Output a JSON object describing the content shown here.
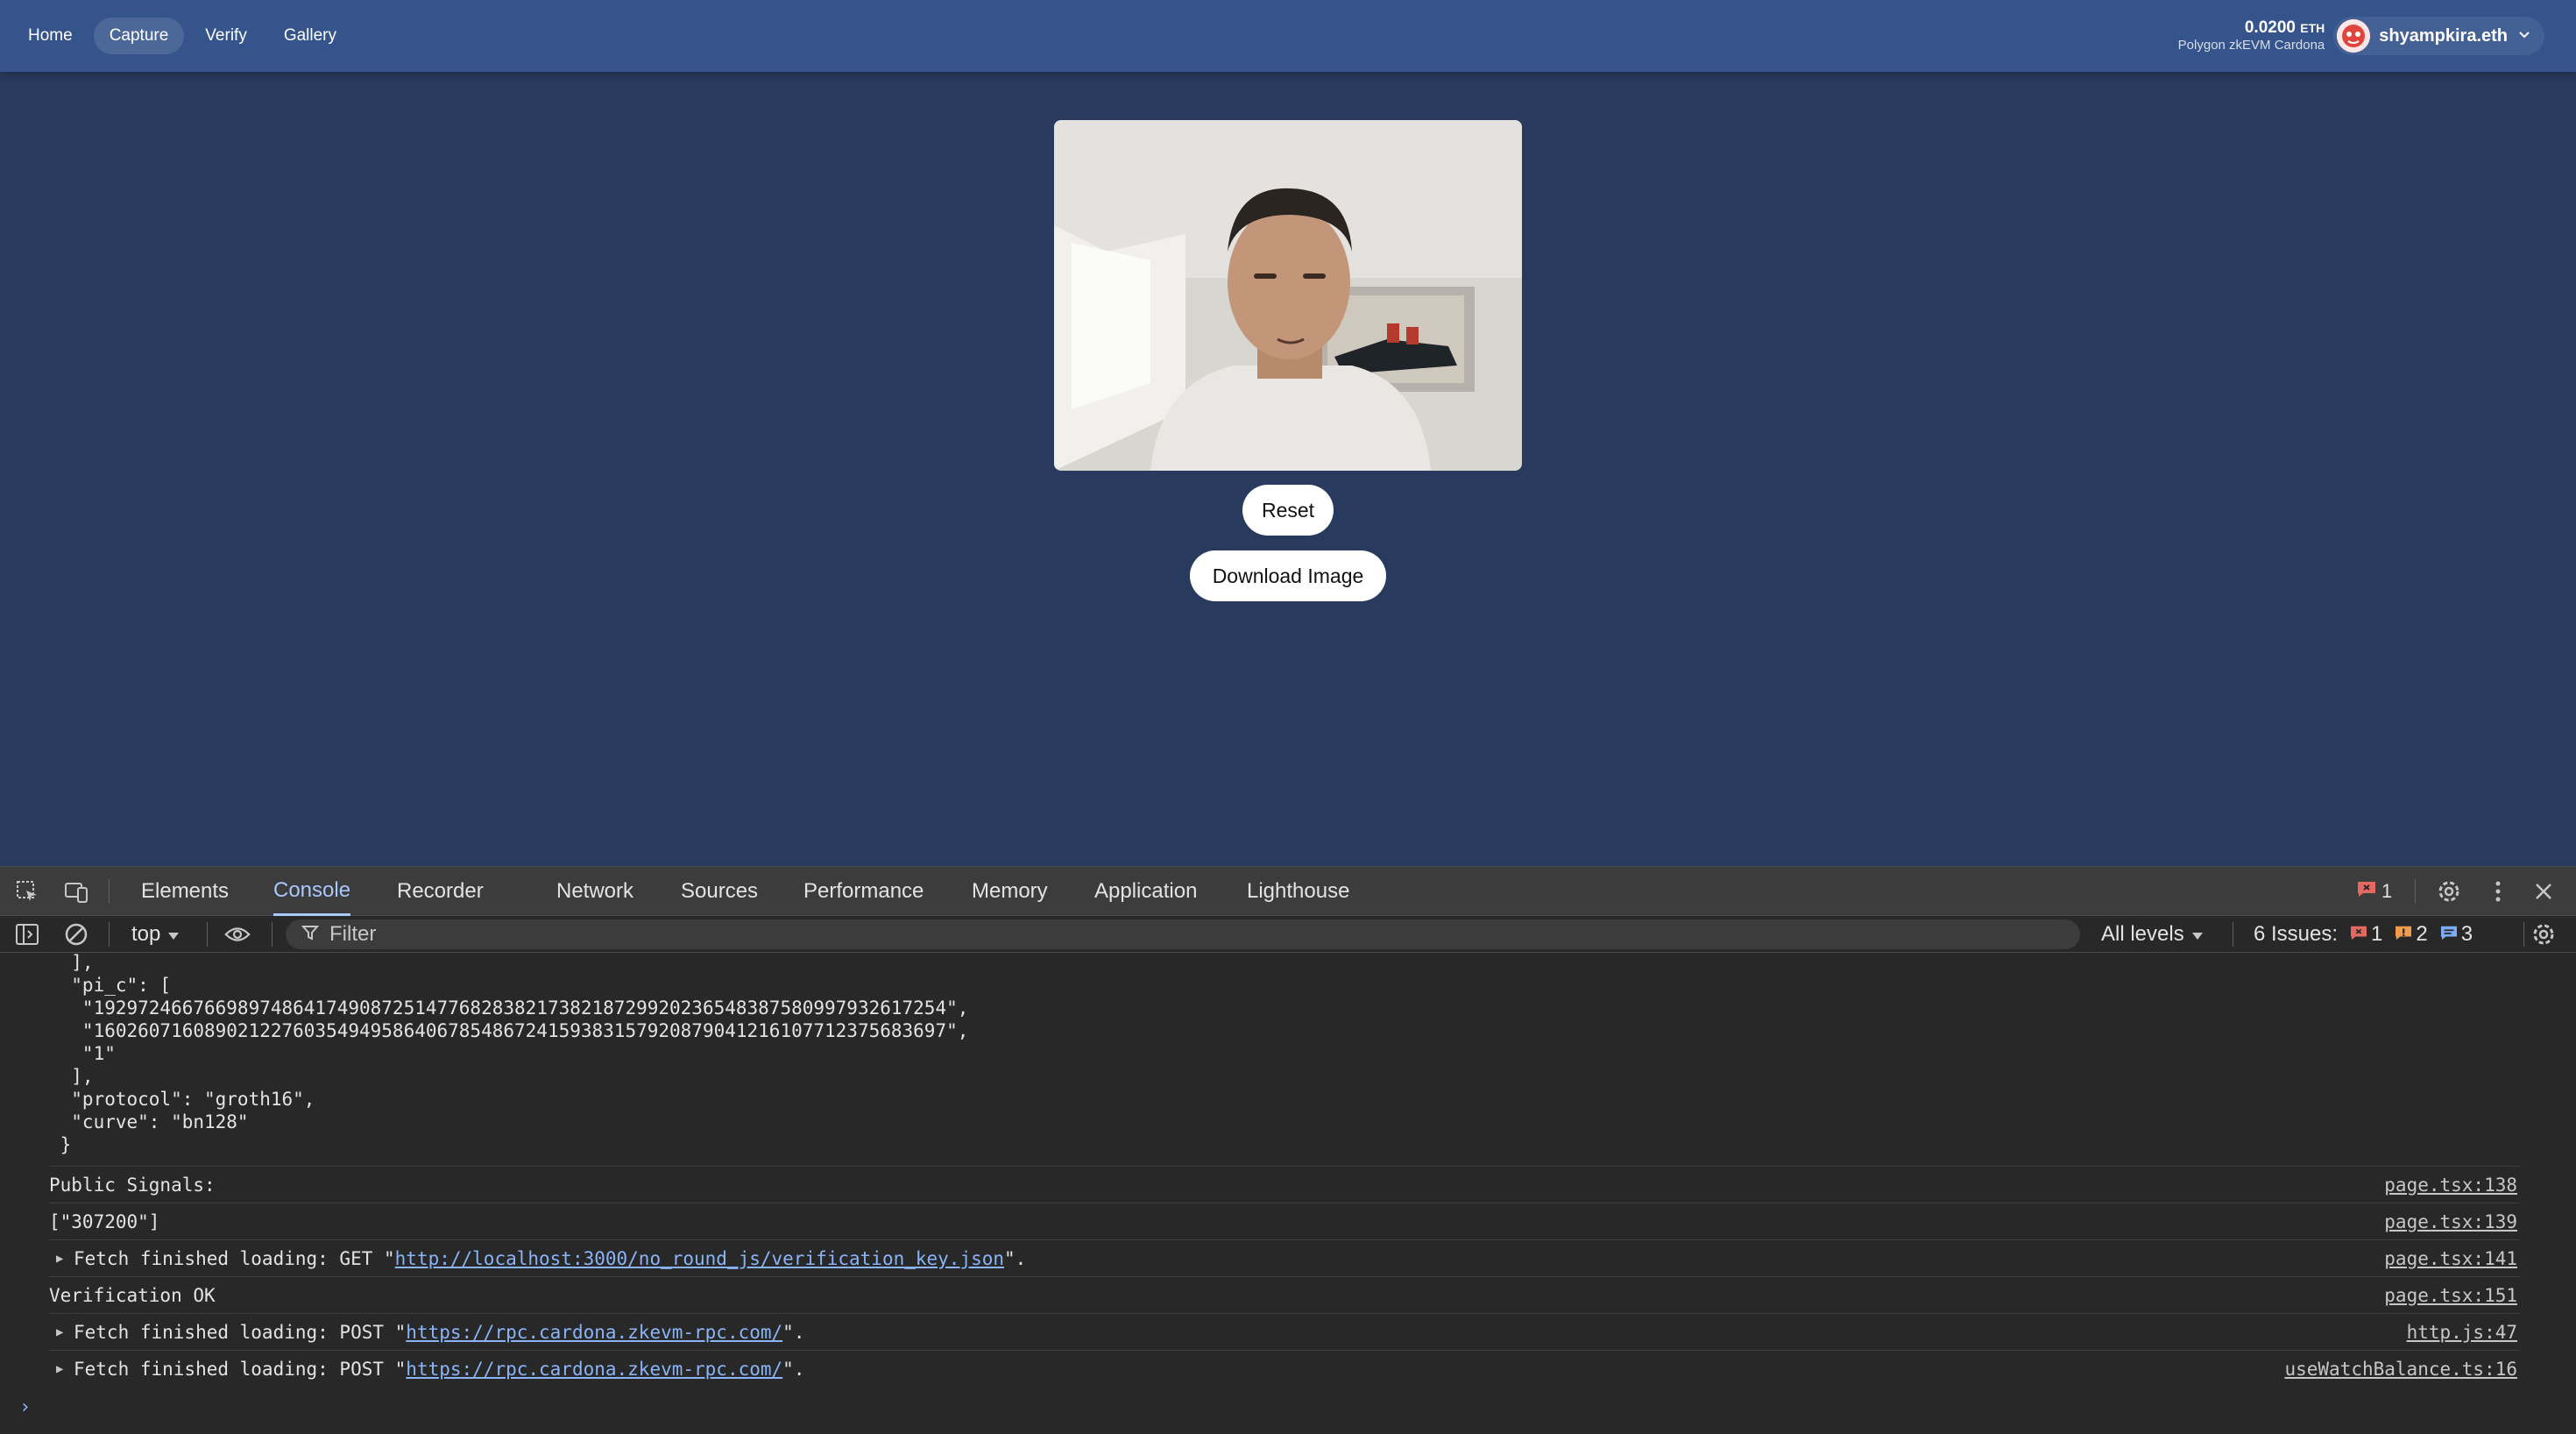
{
  "nav": {
    "links": [
      {
        "label": "Home",
        "active": false
      },
      {
        "label": "Capture",
        "active": true
      },
      {
        "label": "Verify",
        "active": false
      },
      {
        "label": "Gallery",
        "active": false
      }
    ],
    "balance_amount": "0.0200",
    "balance_unit": "ETH",
    "network": "Polygon zkEVM Cardona",
    "account_name": "shyampkira.eth"
  },
  "capture": {
    "reset_label": "Reset",
    "download_label": "Download Image"
  },
  "devtools": {
    "tabs": [
      "Elements",
      "Console",
      "Recorder",
      "Network",
      "Sources",
      "Performance",
      "Memory",
      "Application",
      "Lighthouse"
    ],
    "active_tab": "Console",
    "error_count": "1",
    "context": "top",
    "filter_placeholder": "Filter",
    "levels_label": "All levels",
    "issues_label": "6 Issues:",
    "issues": {
      "errors": "1",
      "warnings": "2",
      "info": "3"
    },
    "json_lines": [
      "  ],",
      "  \"pi_c\": [",
      "   \"19297246676698974864174908725147768283821738218729920236548387580997932617254\",",
      "   \"16026071608902122760354949586406785486724159383157920879041216107712375683697\",",
      "   \"1\"",
      "  ],",
      "  \"protocol\": \"groth16\",",
      "  \"curve\": \"bn128\"",
      " }"
    ],
    "messages": [
      {
        "text": "Public Signals:",
        "source": "page.tsx:138"
      },
      {
        "text": "[\"307200\"]",
        "source": "page.tsx:139"
      },
      {
        "prefix": "Fetch finished loading: GET \"",
        "url": "http://localhost:3000/no_round_js/verification_key.json",
        "suffix": "\".",
        "source": "page.tsx:141"
      },
      {
        "text": "Verification OK",
        "source": "page.tsx:151"
      },
      {
        "prefix": "Fetch finished loading: POST \"",
        "url": "https://rpc.cardona.zkevm-rpc.com/",
        "suffix": "\".",
        "source": "http.js:47"
      },
      {
        "prefix": "Fetch finished loading: POST \"",
        "url": "https://rpc.cardona.zkevm-rpc.com/",
        "suffix": "\".",
        "source": "useWatchBalance.ts:16"
      }
    ]
  },
  "colors": {
    "navbar": "#34548b",
    "page_bg": "#283a5e",
    "devtools_bg": "#282828",
    "accent_blue": "#a8c7fa",
    "error_red": "#e46962",
    "warning_orange": "#f29b4d",
    "info_blue": "#7cacf8"
  },
  "icons": [
    "inspect-element-icon",
    "device-toolbar-icon",
    "settings-gear-icon",
    "more-vert-icon",
    "close-icon",
    "sidebar-toggle-icon",
    "clear-console-icon",
    "eye-icon",
    "filter-funnel-icon",
    "chevron-down-icon"
  ]
}
